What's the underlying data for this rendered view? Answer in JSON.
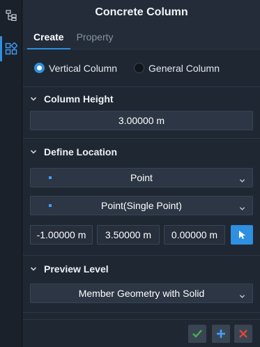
{
  "panel": {
    "title": "Concrete Column",
    "tabs": [
      "Create",
      "Property"
    ],
    "active_tab": "Create"
  },
  "column_type": {
    "options": [
      "Vertical Column",
      "General Column"
    ],
    "selected": "Vertical Column"
  },
  "column_height": {
    "label": "Column Height",
    "value": "3.00000 m"
  },
  "define_location": {
    "label": "Define Location",
    "mode": "Point",
    "sub_mode": "Point(Single Point)",
    "x": "-1.00000 m",
    "y": "3.50000 m",
    "z": "0.00000 m"
  },
  "preview_level": {
    "label": "Preview Level",
    "value": "Member Geometry with Solid"
  },
  "side_rail": {
    "icons": [
      "tree-view-icon",
      "components-icon"
    ],
    "active": "components-icon"
  },
  "actions": {
    "icons": [
      "check-icon",
      "plus-icon",
      "close-icon"
    ]
  },
  "colors": {
    "accent": "#2f8fe0",
    "confirm": "#4caf50",
    "add": "#3fa0ff",
    "cancel": "#e0453a"
  }
}
